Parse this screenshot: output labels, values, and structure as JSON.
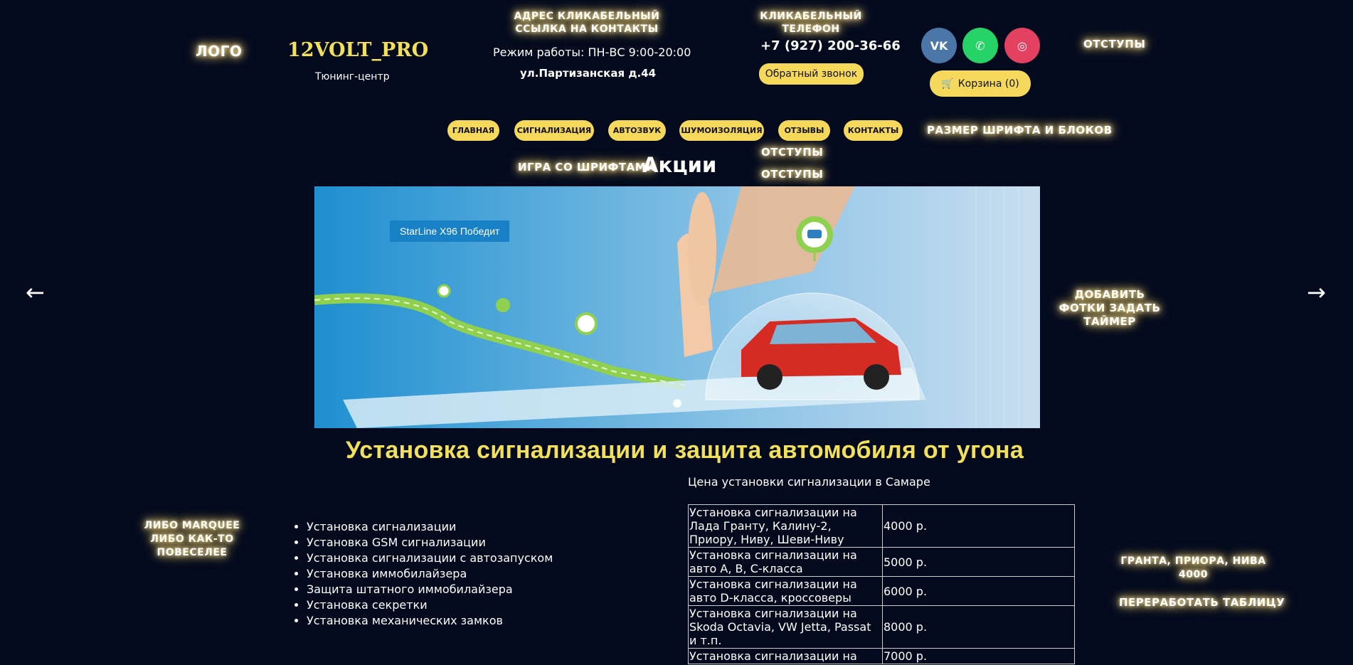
{
  "notes": {
    "logo": "ЛОГО",
    "address_link": "АДРЕС КЛИКАБЕЛЬНЫЙ ССЫЛКА НА КОНТАКТЫ",
    "phone_clickable": "КЛИКАБЕЛЬНЫЙ ТЕЛЕФОН",
    "spacing_top": "ОТСТУПЫ",
    "font_size": "РАЗМЕР ШРИФТА И БЛОКОВ",
    "font_play": "ИГРА СО ШРИФТАМИ",
    "spacing_1": "ОТСТУПЫ",
    "spacing_2": "ОТСТУПЫ",
    "photos_timer": "ДОБАВИТЬ ФОТКИ ЗАДАТЬ ТАЙМЕР",
    "marquee": "ЛИБО MARQUEE ЛИБО КАК-ТО ПОВЕСЕЛЕЕ",
    "granta": "ГРАНТА, ПРИОРА, НИВА 4000",
    "rework_table": "ПЕРЕРАБОТАТЬ ТАБЛИЦУ"
  },
  "header": {
    "brand": "12VOLT_PRO",
    "tagline": "Тюнинг-центр",
    "hours": "Режим работы: ПН-ВС 9:00-20:00",
    "address": "ул.Партизанская д.44",
    "phone": "+7 (927) 200-36-66",
    "callback": "Обратный звонок",
    "cart": "Корзина (0)"
  },
  "social": [
    {
      "name": "vk",
      "glyph": "VK",
      "color": "#4a76a8"
    },
    {
      "name": "whatsapp",
      "glyph": "✆",
      "color": "#25d366"
    },
    {
      "name": "instagram",
      "glyph": "◎",
      "color": "#e4405f"
    }
  ],
  "nav": [
    "Главная",
    "Сигнализация",
    "Автозвук",
    "Шумоизоляция",
    "Отзывы",
    "Контакты"
  ],
  "promo_title": "Акции",
  "slider": {
    "caption": "StarLine X96 Победит",
    "prev": "←",
    "next": "→"
  },
  "main": {
    "heading": "Установка сигнализации и защита автомобиля от угона",
    "price_title": "Цена установки сигнализации в Самаре",
    "services": [
      "Установка сигнализации",
      "Установка GSM сигнализации",
      "Установка сигнализации с автозапуском",
      "Установка иммобилайзера",
      "Защита штатного иммобилайзера",
      "Установка секретки",
      "Установка механических замков"
    ],
    "prices": [
      {
        "service": "Установка сигнализации на Лада Гранту, Калину-2, Приору, Ниву, Шеви-Ниву",
        "price": "4000 р."
      },
      {
        "service": "Установка сигнализации на авто А, В, С-класса",
        "price": "5000 р."
      },
      {
        "service": "Установка сигнализации на авто D-класса, кроссоверы",
        "price": "6000 р."
      },
      {
        "service": "Установка сигнализации на Skoda Octavia, VW Jetta, Passat и т.п.",
        "price": "8000 р."
      },
      {
        "service": "Установка сигнализации на",
        "price": "7000 р."
      }
    ]
  }
}
